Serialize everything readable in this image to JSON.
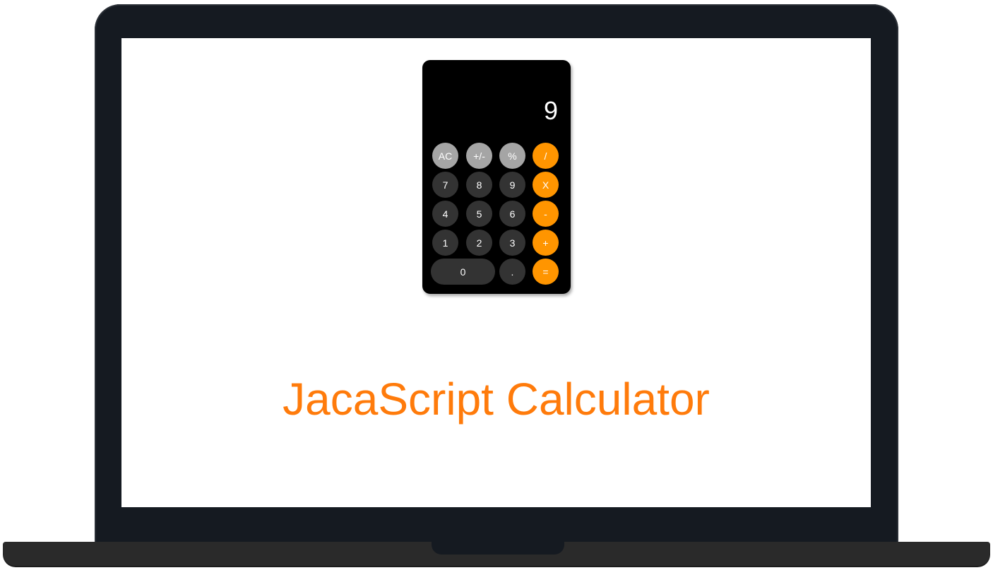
{
  "calculator": {
    "display": "9",
    "rows": [
      [
        {
          "label": "AC",
          "name": "clear-button",
          "style": "gray"
        },
        {
          "label": "+/-",
          "name": "sign-toggle-button",
          "style": "gray"
        },
        {
          "label": "%",
          "name": "percent-button",
          "style": "gray"
        },
        {
          "label": "/",
          "name": "divide-button",
          "style": "orange"
        }
      ],
      [
        {
          "label": "7",
          "name": "digit-7-button",
          "style": "dark"
        },
        {
          "label": "8",
          "name": "digit-8-button",
          "style": "dark"
        },
        {
          "label": "9",
          "name": "digit-9-button",
          "style": "dark"
        },
        {
          "label": "X",
          "name": "multiply-button",
          "style": "orange"
        }
      ],
      [
        {
          "label": "4",
          "name": "digit-4-button",
          "style": "dark"
        },
        {
          "label": "5",
          "name": "digit-5-button",
          "style": "dark"
        },
        {
          "label": "6",
          "name": "digit-6-button",
          "style": "dark"
        },
        {
          "label": "-",
          "name": "subtract-button",
          "style": "orange"
        }
      ],
      [
        {
          "label": "1",
          "name": "digit-1-button",
          "style": "dark"
        },
        {
          "label": "2",
          "name": "digit-2-button",
          "style": "dark"
        },
        {
          "label": "3",
          "name": "digit-3-button",
          "style": "dark"
        },
        {
          "label": "+",
          "name": "add-button",
          "style": "orange"
        }
      ],
      [
        {
          "label": "0",
          "name": "digit-0-button",
          "style": "dark"
        },
        {
          "label": ".",
          "name": "decimal-button",
          "style": "dark"
        },
        {
          "label": "=",
          "name": "equals-button",
          "style": "orange"
        }
      ]
    ]
  },
  "page": {
    "title": "JacaScript Calculator"
  },
  "colors": {
    "accent": "#ff9500",
    "title": "#ff7b0b",
    "function_key": "#a5a5a5",
    "digit_key": "#333333",
    "calculator_body": "#000000",
    "laptop_bezel": "#151a21"
  }
}
